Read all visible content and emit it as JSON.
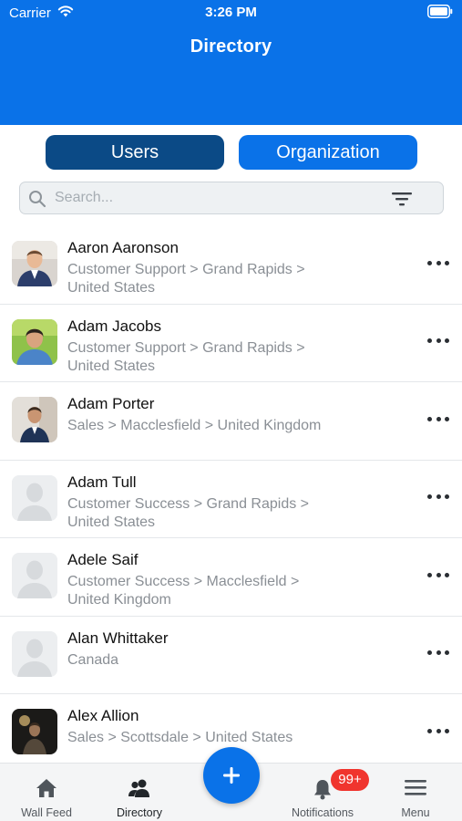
{
  "status_bar": {
    "carrier": "Carrier",
    "time": "3:26 PM"
  },
  "header": {
    "title": "Directory"
  },
  "segments": {
    "users": "Users",
    "organization": "Organization"
  },
  "search": {
    "placeholder": "Search..."
  },
  "people": [
    {
      "name": "Aaron Aaronson",
      "detail": "Customer Support > Grand Rapids > United States",
      "avatar": "photo"
    },
    {
      "name": "Adam Jacobs",
      "detail": "Customer Support > Grand Rapids > United States",
      "avatar": "photo"
    },
    {
      "name": "Adam Porter",
      "detail": "Sales > Macclesfield > United Kingdom",
      "avatar": "photo"
    },
    {
      "name": "Adam Tull",
      "detail": "Customer Success > Grand Rapids > United States",
      "avatar": "placeholder"
    },
    {
      "name": "Adele Saif",
      "detail": "Customer Success > Macclesfield > United Kingdom",
      "avatar": "placeholder"
    },
    {
      "name": "Alan Whittaker",
      "detail": "Canada",
      "avatar": "placeholder"
    },
    {
      "name": "Alex Allion",
      "detail": "Sales > Scottsdale > United States",
      "avatar": "photo"
    }
  ],
  "tabbar": {
    "wall_feed": "Wall Feed",
    "directory": "Directory",
    "notifications": "Notifications",
    "menu": "Menu",
    "badge": "99+"
  },
  "icons": {
    "wifi": "wifi-icon",
    "battery": "battery-icon",
    "search": "search-icon",
    "filter": "filter-icon",
    "more": "more-icon",
    "home": "home-icon",
    "people": "people-icon",
    "plus": "plus-icon",
    "bell": "bell-icon",
    "hamburger": "hamburger-icon"
  },
  "colors": {
    "primary": "#0a72e8",
    "segment_active": "#0b4a86",
    "badge": "#f0352e"
  }
}
